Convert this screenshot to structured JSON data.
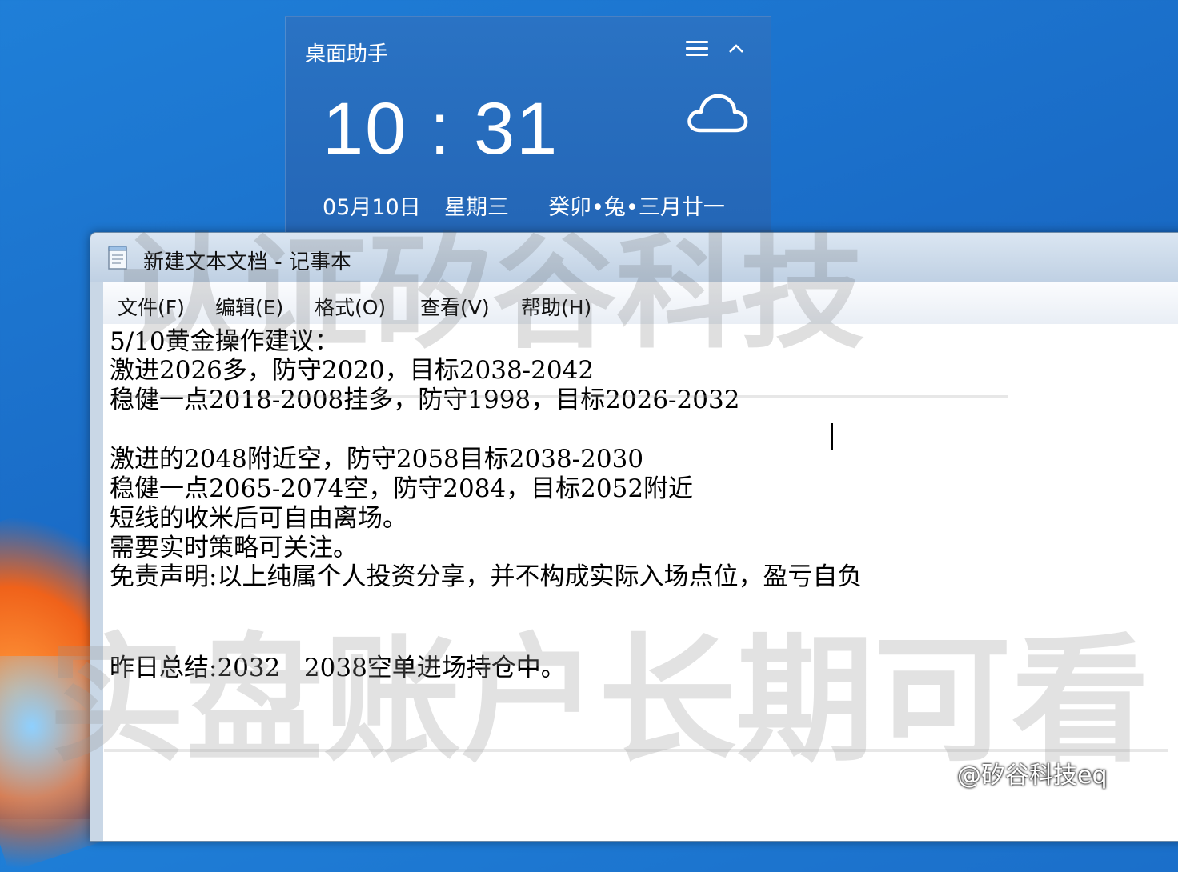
{
  "widget": {
    "title": "桌面助手",
    "time": "10 : 31",
    "date": "05月10日",
    "weekday": "星期三",
    "lunar": "癸卯•兔•三月廿一",
    "weather_icon": "cloud-icon"
  },
  "notepad": {
    "title": "新建文本文档 - 记事本",
    "menu": [
      "文件(F)",
      "编辑(E)",
      "格式(O)",
      "查看(V)",
      "帮助(H)"
    ],
    "lines": [
      "5/10黄金操作建议：",
      "激进2026多，防守2020，目标2038-2042",
      "稳健一点2018-2008挂多，防守1998，目标2026-2032",
      "",
      "激进的2048附近空，防守2058目标2038-2030",
      "稳健一点2065-2074空，防守2084，目标2052附近",
      "短线的收米后可自由离场。",
      "需要实时策略可关注。",
      "免责声明:以上纯属个人投资分享，并不构成实际入场点位，盈亏自负",
      "",
      "",
      "昨日总结:2032   2038空单进场持仓中。"
    ]
  },
  "watermarks": {
    "top": "认证矽谷科技",
    "bottom": "实盘账户长期可看"
  },
  "credit": "@矽谷科技eq"
}
